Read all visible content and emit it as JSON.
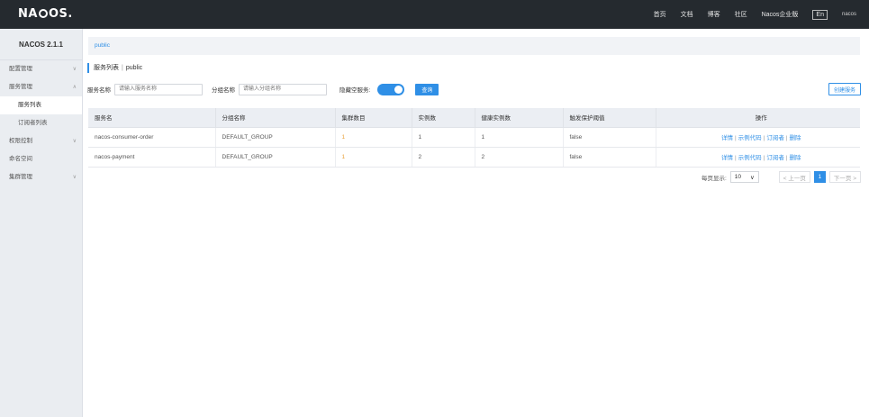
{
  "header": {
    "logo": "NACOS.",
    "nav": [
      "首页",
      "文档",
      "博客",
      "社区",
      "Nacos企业版"
    ],
    "lang": "En",
    "user": "nacos"
  },
  "sidebar": {
    "version": "NACOS 2.1.1",
    "items": [
      {
        "label": "配置管理",
        "chevron": "∨"
      },
      {
        "label": "服务管理",
        "chevron": "∧"
      },
      {
        "label": "服务列表",
        "chevron": ""
      },
      {
        "label": "订阅者列表",
        "chevron": ""
      },
      {
        "label": "权限控制",
        "chevron": "∨"
      },
      {
        "label": "命名空间",
        "chevron": ""
      },
      {
        "label": "集群管理",
        "chevron": "∨"
      }
    ]
  },
  "namespace": "public",
  "title": {
    "main": "服务列表",
    "sep": "|",
    "ns": "public"
  },
  "filters": {
    "service_label": "服务名称",
    "service_placeholder": "请输入服务名称",
    "group_label": "分组名称",
    "group_placeholder": "请输入分组名称",
    "hide_empty_label": "隐藏空服务:",
    "query_button": "查询",
    "create_button": "创建服务"
  },
  "table": {
    "columns": [
      "服务名",
      "分组名称",
      "集群数目",
      "实例数",
      "健康实例数",
      "触发保护阈值",
      "操作"
    ],
    "rows": [
      [
        "nacos-consumer-order",
        "DEFAULT_GROUP",
        "1",
        "1",
        "1",
        "false"
      ],
      [
        "nacos-payment",
        "DEFAULT_GROUP",
        "1",
        "2",
        "2",
        "false"
      ]
    ],
    "ops": [
      "详情",
      "示例代码",
      "订阅者",
      "删除"
    ]
  },
  "pager": {
    "label": "每页显示:",
    "page_size": "10",
    "prev": "< 上一页",
    "current": "1",
    "next": "下一页 >"
  },
  "colors": {
    "primary": "#2f8fe6",
    "header_bg": "#252a2f",
    "accent": "#e9a23b"
  }
}
